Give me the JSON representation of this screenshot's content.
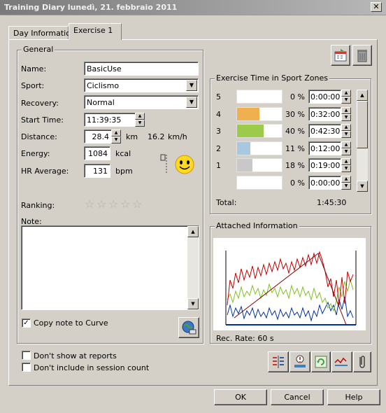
{
  "window": {
    "title": "Training Diary   lunedì, 21. febbraio 2011",
    "close_glyph": "✕"
  },
  "tabs": [
    {
      "label": "Day Information",
      "active": false
    },
    {
      "label": "Exercise 1",
      "active": true
    }
  ],
  "general": {
    "legend": "General",
    "name_label": "Name:",
    "name_value": "BasicUse",
    "sport_label": "Sport:",
    "sport_value": "Ciclismo",
    "recovery_label": "Recovery:",
    "recovery_value": "Normal",
    "start_time_label": "Start Time:",
    "start_time_value": "11:39:35",
    "distance_label": "Distance:",
    "distance_value": "28.4",
    "distance_unit": "km",
    "speed_value": "16.2",
    "speed_unit": "km/h",
    "energy_label": "Energy:",
    "energy_value": "1084",
    "energy_unit": "kcal",
    "hr_label": "HR Average:",
    "hr_value": "131",
    "hr_unit": "bpm",
    "ranking_label": "Ranking:",
    "ranking_stars": 0,
    "ranking_max": 5,
    "note_label": "Note:",
    "note_value": "",
    "copy_note_label": "Copy note to Curve",
    "copy_note_checked": true
  },
  "zones": {
    "legend": "Exercise Time in Sport Zones",
    "rows": [
      {
        "zone": "5",
        "percent": "0 %",
        "time": "0:00:00",
        "fill": 0.0,
        "color": "#ffffff"
      },
      {
        "zone": "4",
        "percent": "30 %",
        "time": "0:32:00",
        "fill": 0.5,
        "color": "#f0b050"
      },
      {
        "zone": "3",
        "percent": "40 %",
        "time": "0:42:30",
        "fill": 0.6,
        "color": "#9ccb4c"
      },
      {
        "zone": "2",
        "percent": "11 %",
        "time": "0:12:00",
        "fill": 0.3,
        "color": "#a8c8e0"
      },
      {
        "zone": "1",
        "percent": "18 %",
        "time": "0:19:00",
        "fill": 0.35,
        "color": "#c8c8c8"
      },
      {
        "zone": "",
        "percent": "0 %",
        "time": "0:00:00",
        "fill": 0.0,
        "color": "#ffffff"
      }
    ],
    "total_label": "Total:",
    "total_value": "1:45:30"
  },
  "attached": {
    "legend": "Attached Information",
    "rec_rate": "Rec. Rate: 60 s"
  },
  "options": {
    "dont_show_reports": "Don't show at reports",
    "dont_include_count": "Don't include in session count"
  },
  "buttons": {
    "ok": "OK",
    "cancel": "Cancel",
    "help": "Help"
  },
  "colors": {
    "series_red": "#c00000",
    "series_green": "#80c020",
    "series_blue": "#0030a0",
    "series_darkred": "#800000"
  }
}
